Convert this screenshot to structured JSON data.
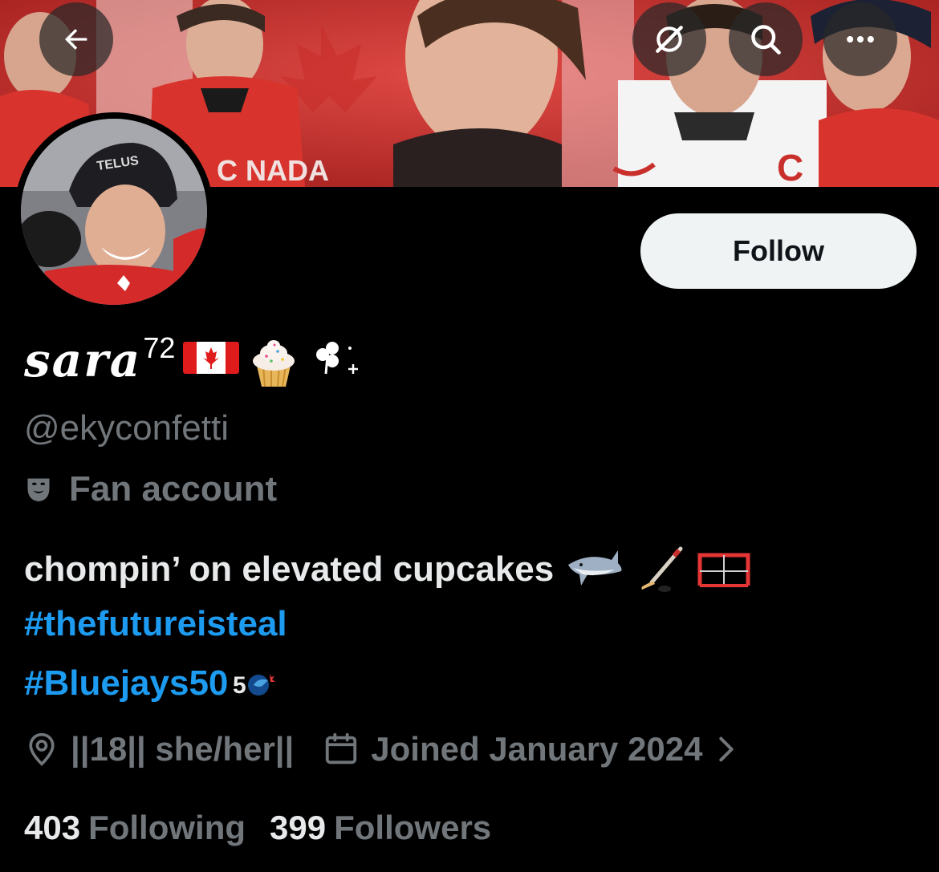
{
  "header": {
    "back_icon": "arrow-left-icon",
    "grok_icon": "grok-icon",
    "search_icon": "search-icon",
    "more_icon": "more-horizontal-icon"
  },
  "profile": {
    "display_name": "sara",
    "display_name_suffix": "72",
    "handle": "@ekyconfetti",
    "category": "Fan account",
    "follow_label": "Follow"
  },
  "bio": {
    "line1": "chompin’ on elevated cupcakes",
    "hashtag1": "#thefutureisteal",
    "hashtag2": "#Bluejays50"
  },
  "meta": {
    "location": "||18|| she/her||",
    "joined": "Joined January 2024"
  },
  "stats": {
    "following_count": "403",
    "following_label": "Following",
    "followers_count": "399",
    "followers_label": "Followers"
  },
  "colors": {
    "background": "#000000",
    "link": "#1d9bf0",
    "secondary_text": "#71767b",
    "follow_button_bg": "#eff3f4"
  }
}
